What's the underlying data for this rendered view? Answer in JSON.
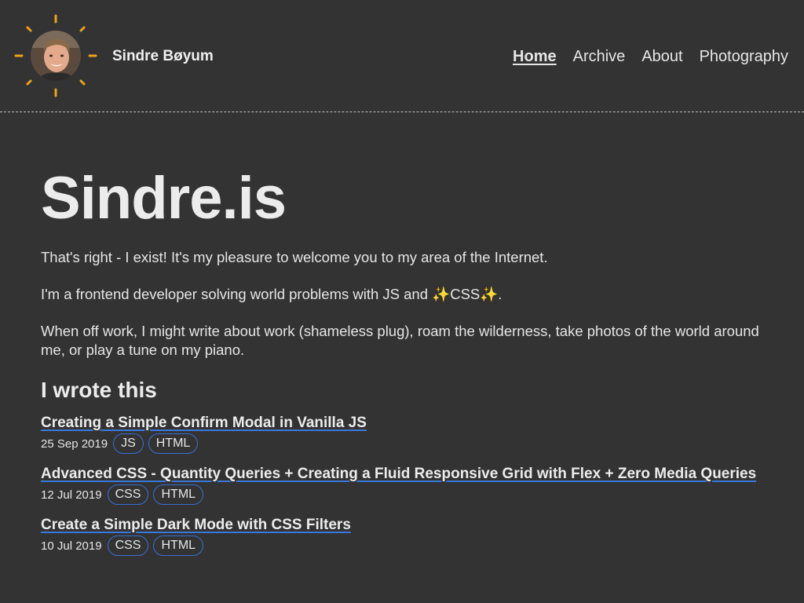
{
  "header": {
    "site_name": "Sindre Bøyum",
    "nav": [
      {
        "label": "Home",
        "active": true
      },
      {
        "label": "Archive",
        "active": false
      },
      {
        "label": "About",
        "active": false
      },
      {
        "label": "Photography",
        "active": false
      }
    ]
  },
  "hero": {
    "title": "Sindre.is"
  },
  "intro": {
    "p1": "That's right - I exist! It's my pleasure to welcome you to my area of the Internet.",
    "p2_before": "I'm a frontend developer solving world problems with JS and ",
    "p2_sparkle": "✨",
    "p2_css": "CSS",
    "p2_after": ".",
    "p3": "When off work, I might write about work (shameless plug), roam the wilderness, take photos of the world around me, or play a tune on my piano."
  },
  "posts_section": {
    "title": "I wrote this",
    "posts": [
      {
        "title": "Creating a Simple Confirm Modal in Vanilla JS",
        "date": "25 Sep 2019",
        "tags": [
          "JS",
          "HTML"
        ]
      },
      {
        "title": "Advanced CSS - Quantity Queries + Creating a Fluid Responsive Grid with Flex + Zero Media Queries",
        "date": "12 Jul 2019",
        "tags": [
          "CSS",
          "HTML"
        ]
      },
      {
        "title": "Create a Simple Dark Mode with CSS Filters",
        "date": "10 Jul 2019",
        "tags": [
          "CSS",
          "HTML"
        ]
      }
    ]
  },
  "colors": {
    "background": "#333333",
    "sun_rays": "#f0a21a",
    "link_underline": "#3a78d8",
    "tag_border": "#3a6fd0"
  },
  "icons": {
    "avatar": "profile-photo",
    "sun_rays": "sun-rays-icon"
  }
}
